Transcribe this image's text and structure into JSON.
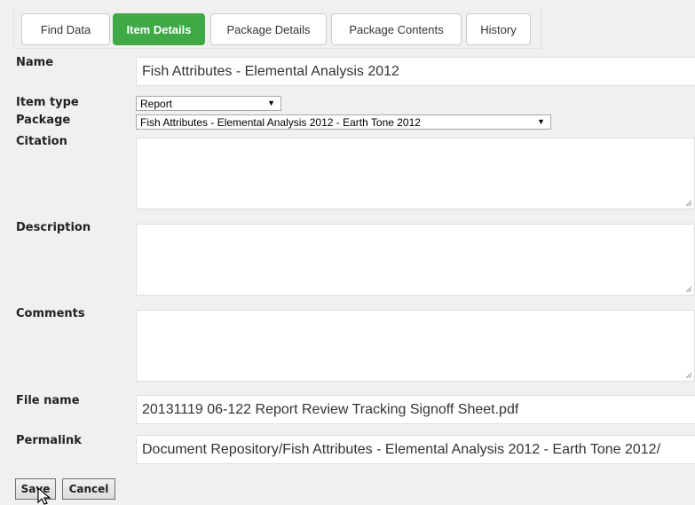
{
  "tabs": [
    {
      "label": "Find Data",
      "active": false
    },
    {
      "label": "Item Details",
      "active": true
    },
    {
      "label": "Package Details",
      "active": false
    },
    {
      "label": "Package Contents",
      "active": false
    },
    {
      "label": "History",
      "active": false
    }
  ],
  "form": {
    "name_label": "Name",
    "name_value": "Fish Attributes - Elemental Analysis 2012",
    "item_type_label": "Item type",
    "item_type_value": "Report",
    "package_label": "Package",
    "package_value": "Fish Attributes - Elemental Analysis 2012 - Earth Tone 2012",
    "citation_label": "Citation",
    "citation_value": "",
    "description_label": "Description",
    "description_value": "",
    "comments_label": "Comments",
    "comments_value": "",
    "file_name_label": "File name",
    "file_name_value": "20131119 06-122 Report Review Tracking Signoff Sheet.pdf",
    "permalink_label": "Permalink",
    "permalink_value": "Document Repository/Fish Attributes - Elemental Analysis 2012 - Earth Tone 2012/"
  },
  "actions": {
    "save_label": "Save",
    "cancel_label": "Cancel"
  },
  "colors": {
    "active_tab": "#3fa946",
    "background": "#f0f0f0"
  }
}
